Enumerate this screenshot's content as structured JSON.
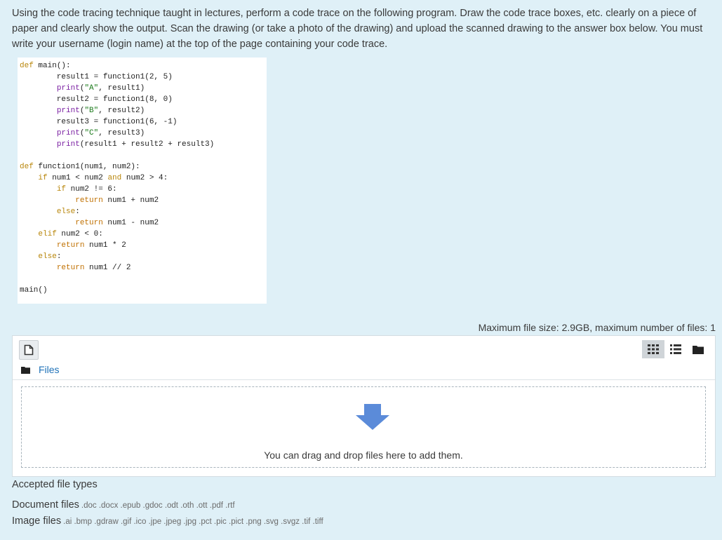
{
  "question": {
    "text": "Using the code tracing technique taught in lectures, perform a code trace on the following program. Draw the code trace boxes, etc. clearly on a piece of paper and clearly show the output. Scan the drawing (or take a photo of the drawing) and upload the scanned drawing to the answer box below. You must write your username (login name) at the top of the page containing your code trace."
  },
  "code": {
    "l1_kw": "def",
    "l1_rest": " main():",
    "l2": "        result1 = function1(2, 5)",
    "l3_fn": "print",
    "l3_str": "\"A\"",
    "l3_rest": ", result1)",
    "l4": "        result2 = function1(8, 0)",
    "l5_fn": "print",
    "l5_str": "\"B\"",
    "l5_rest": ", result2)",
    "l6": "        result3 = function1(6, -1)",
    "l7_fn": "print",
    "l7_str": "\"C\"",
    "l7_rest": ", result3)",
    "l8_fn": "print",
    "l8_rest": "(result1 + result2 + result3)",
    "l10_kw": "def",
    "l10_rest": " function1(num1, num2):",
    "l11_kw": "if",
    "l11_a": " num1 < num2 ",
    "l11_kw2": "and",
    "l11_b": " num2 > 4:",
    "l12_kw": "if",
    "l12_rest": " num2 != 6:",
    "l13_ret": "return",
    "l13_rest": " num1 + num2",
    "l14_kw": "else",
    "l14_rest": ":",
    "l15_ret": "return",
    "l15_rest": " num1 - num2",
    "l16_kw": "elif",
    "l16_rest": " num2 < 0:",
    "l17_ret": "return",
    "l17_rest": " num1 * 2",
    "l18_kw": "else",
    "l18_rest": ":",
    "l19_ret": "return",
    "l19_rest": " num1 // 2",
    "l21": "main()"
  },
  "filemanager": {
    "max_size_text": "Maximum file size: 2.9GB, maximum number of files: 1",
    "path_label": "Files",
    "drop_text": "You can drag and drop files here to add them."
  },
  "accepted": {
    "title": "Accepted file types",
    "doc_label": "Document files",
    "doc_exts": ".doc .docx .epub .gdoc .odt .oth .ott .pdf .rtf",
    "img_label": "Image files",
    "img_exts": ".ai .bmp .gdraw .gif .ico .jpe .jpeg .jpg .pct .pic .pict .png .svg .svgz .tif .tiff"
  },
  "icons": {
    "new_file": "new-file-icon",
    "view_icons": "grid-view-icon",
    "view_list": "list-view-icon",
    "view_tree": "folder-view-icon",
    "folder": "folder-icon",
    "drop_arrow": "download-arrow-icon"
  },
  "colors": {
    "link": "#1f72b8",
    "arrow": "#5b8bd9",
    "background": "#dff0f7"
  }
}
